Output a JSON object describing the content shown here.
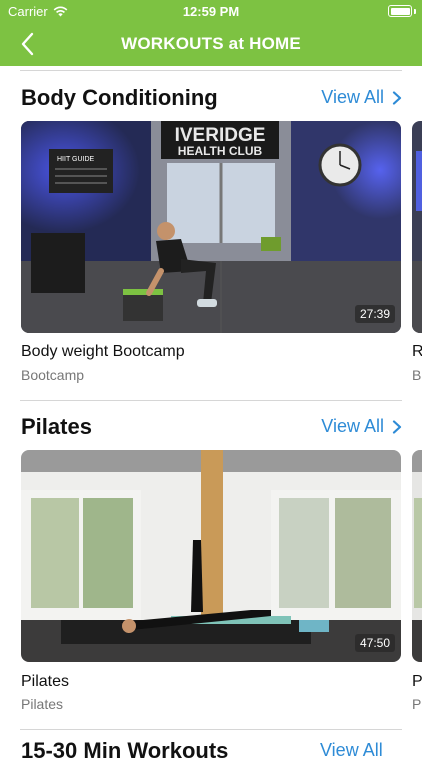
{
  "status": {
    "carrier": "Carrier",
    "time": "12:59 PM"
  },
  "nav": {
    "title": "WORKOUTS at HOME"
  },
  "sections": [
    {
      "title": "Body Conditioning",
      "view_all": "View All",
      "card": {
        "title": "Body weight Bootcamp",
        "subtitle": "Bootcamp",
        "duration": "27:39",
        "sign_top": "IVERIDGE",
        "sign_bottom": "HEALTH CLUB",
        "board_title": "HIIT GUIDE"
      },
      "peek": {
        "title": "R",
        "subtitle": "Ba"
      }
    },
    {
      "title": "Pilates",
      "view_all": "View All",
      "card": {
        "title": "Pilates",
        "subtitle": "Pilates",
        "duration": "47:50"
      },
      "peek": {
        "title": "P",
        "subtitle": "Pi"
      }
    }
  ],
  "next_section": {
    "title": "15-30 Min Workouts",
    "view_all": "View All"
  },
  "colors": {
    "header": "#7dc242",
    "link": "#2e8bd6"
  }
}
